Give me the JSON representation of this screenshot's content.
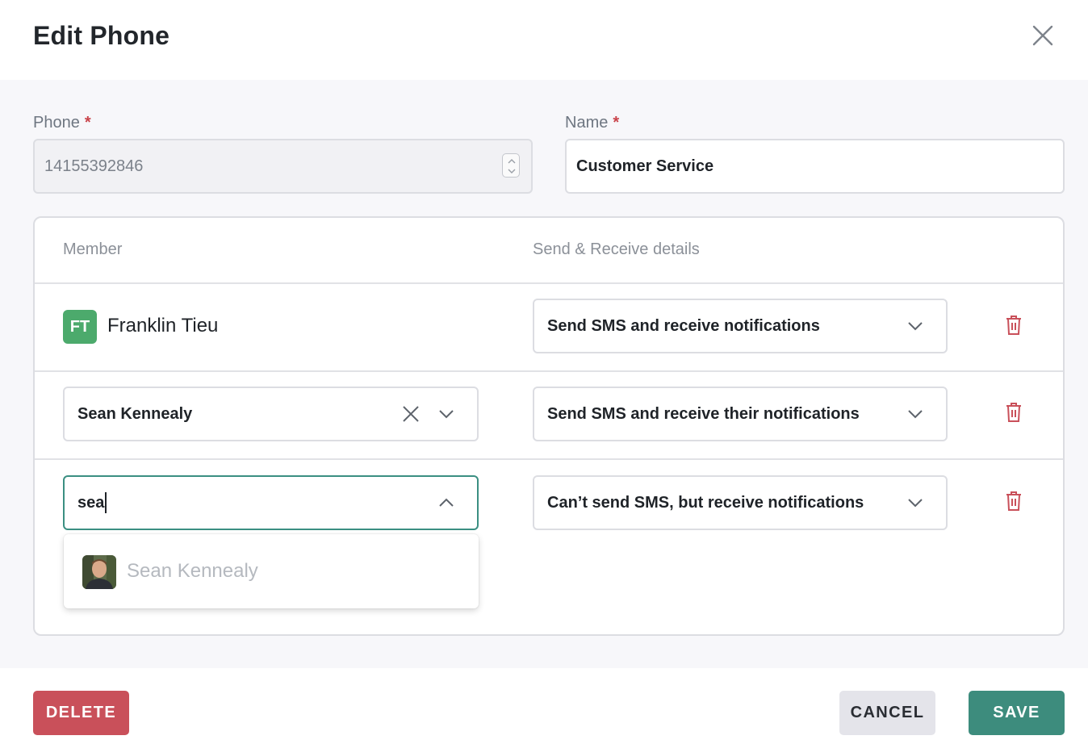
{
  "dialog": {
    "title": "Edit Phone"
  },
  "form": {
    "phone_label": "Phone",
    "phone_value": "14155392846",
    "name_label": "Name",
    "name_value": "Customer Service",
    "required_marker": "*"
  },
  "members": {
    "column_member": "Member",
    "column_details": "Send & Receive details",
    "rows": [
      {
        "initials": "FT",
        "name": "Franklin Tieu",
        "details": "Send SMS and receive notifications"
      },
      {
        "name": "Sean Kennealy",
        "details": "Send SMS and receive their notifications"
      },
      {
        "search_value": "sea",
        "details": "Can’t send SMS, but receive notifications"
      }
    ],
    "dropdown_options": [
      {
        "name": "Sean Kennealy"
      }
    ]
  },
  "footer": {
    "delete_label": "DELETE",
    "cancel_label": "CANCEL",
    "save_label": "SAVE"
  },
  "colors": {
    "danger": "#c9505a",
    "primary": "#3d8c7d",
    "avatar_green": "#4caa6c"
  }
}
